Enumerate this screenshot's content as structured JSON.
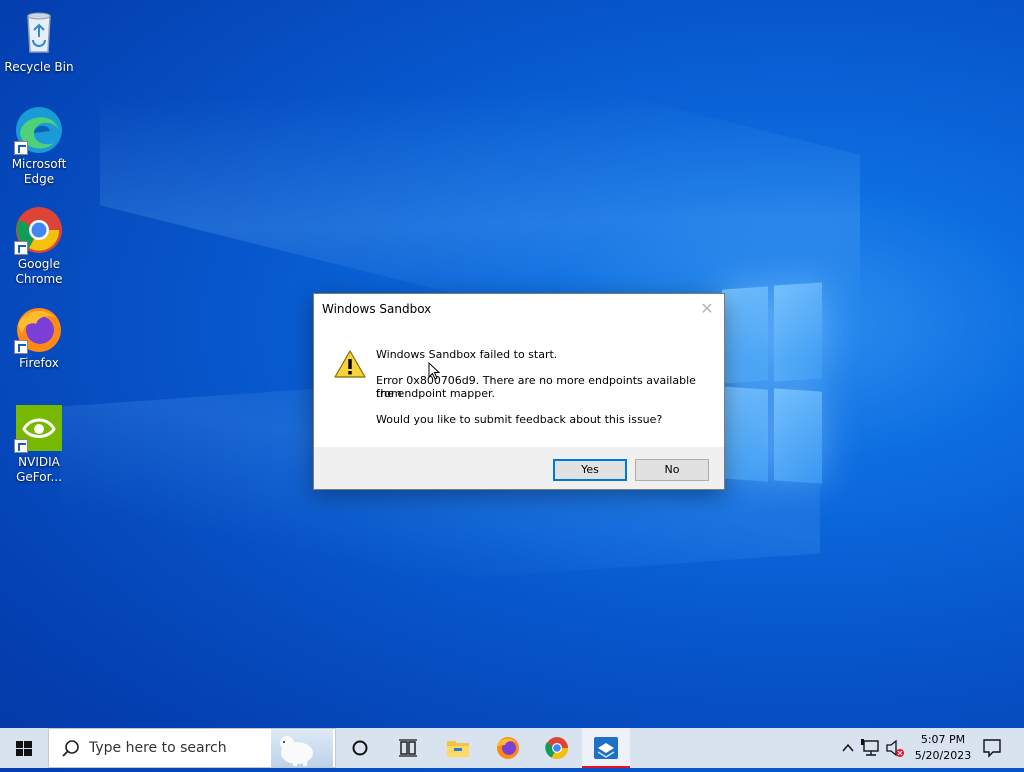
{
  "desktop": {
    "icons": [
      {
        "label": "Recycle Bin",
        "icon": "recycle-bin-icon"
      },
      {
        "label": "Microsoft Edge",
        "icon": "edge-icon"
      },
      {
        "label": "Google Chrome",
        "icon": "chrome-icon"
      },
      {
        "label": "Firefox",
        "icon": "firefox-icon"
      },
      {
        "label": "NVIDIA GeFor...",
        "icon": "nvidia-icon"
      }
    ]
  },
  "dialog": {
    "title": "Windows Sandbox",
    "message": "Windows Sandbox failed to start.",
    "error_line1": "Error 0x800706d9. There are no more endpoints available from",
    "error_line2": "the endpoint mapper.",
    "question": "Would you like to submit feedback about this issue?",
    "yes_label": "Yes",
    "no_label": "No",
    "icon": "warning-icon",
    "close_icon": "close-icon"
  },
  "taskbar": {
    "search_placeholder": "Type here to search",
    "apps": [
      "cortana-icon",
      "task-view-icon",
      "file-explorer-icon",
      "firefox-icon",
      "chrome-icon",
      "windows-sandbox-icon"
    ],
    "active_app": "windows-sandbox-icon",
    "clock_time": "5:07 PM",
    "clock_date": "5/20/2023"
  },
  "colors": {
    "desktop_blue": "#0757cc",
    "taskbar": "#d9e2ef",
    "active_indicator": "#e81123",
    "default_button_border": "#0078d7"
  }
}
